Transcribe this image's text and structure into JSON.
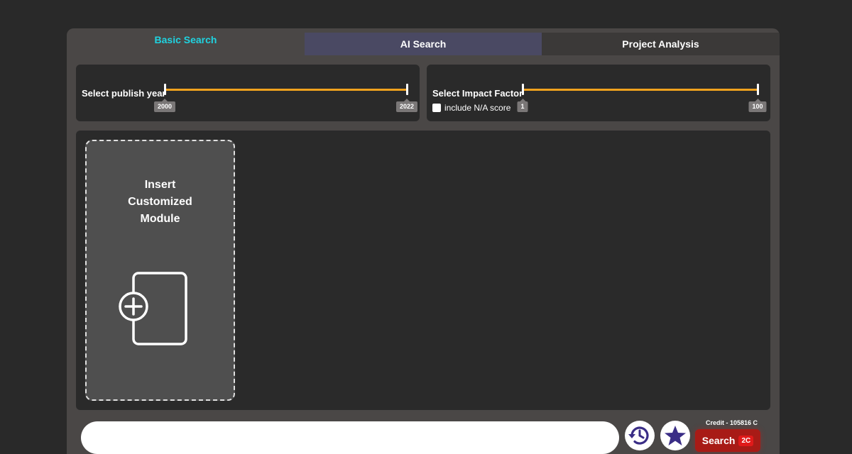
{
  "tabs": {
    "basic": "Basic Search",
    "ai": "AI Search",
    "project": "Project Analysis"
  },
  "year_filter": {
    "label": "Select publish year",
    "min": "2000",
    "max": "2022"
  },
  "impact_filter": {
    "label": "Select Impact Factor",
    "min": "1",
    "max": "100",
    "na_label": "include N/A score"
  },
  "module_card": {
    "title_line1": "Insert",
    "title_line2": "Customized",
    "title_line3": "Module",
    "icon": "add-page-icon"
  },
  "search_bar": {
    "placeholder": "",
    "history_icon": "history-icon",
    "star_icon": "star-icon",
    "credit": "Credit - 105816 C",
    "search_label": "Search",
    "cost": "2C"
  },
  "colors": {
    "accent_tab": "#1fd3e0",
    "slider_track": "#f0a21e",
    "search_button": "#a81b16",
    "icon_purple": "#3a2d86"
  }
}
